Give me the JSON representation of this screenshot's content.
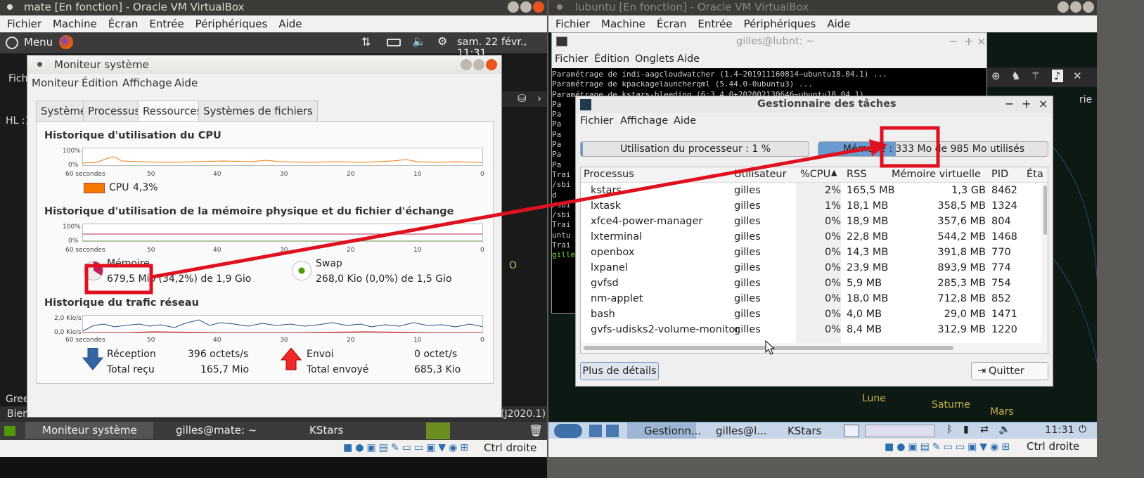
{
  "left_vm": {
    "title": "mate [En fonction] - Oracle VM VirtualBox",
    "menu": [
      "Fichier",
      "Machine",
      "Écran",
      "Entrée",
      "Périphériques",
      "Aide"
    ],
    "panel": {
      "menu_label": "Menu",
      "clock": "sam. 22 févr., 11:31"
    },
    "sysmon": {
      "title": "Moniteur système",
      "menu": [
        "Moniteur",
        "Édition",
        "Affichage",
        "Aide"
      ],
      "tabs": [
        "Système",
        "Processus",
        "Ressources",
        "Systèmes de fichiers"
      ],
      "cpu_title": "Historique d'utilisation du CPU",
      "mem_title": "Historique d'utilisation de la mémoire physique et du fichier d'échange",
      "net_title": "Historique du trafic réseau",
      "y100": "100%",
      "y0": "0%",
      "net_y1": "2,0 Kio/s",
      "net_y0": "0,0 Kio/s",
      "x_labels": [
        "60 secondes",
        "50",
        "40",
        "30",
        "20",
        "10",
        "0"
      ],
      "cpu_legend": "CPU",
      "cpu_value": "4,3%",
      "mem_label": "Mémoire",
      "mem_value": "679,5 Mio (34,2%) de 1,9 Gio",
      "swap_label": "Swap",
      "swap_value": "268,0 Kio (0,0%) de 1,5 Gio",
      "rx_label": "Réception",
      "rx_rate": "396 octets/s",
      "rx_total_label": "Total reçu",
      "rx_total": "165,7 Mio",
      "tx_label": "Envoi",
      "tx_rate": "0 octet/s",
      "tx_total_label": "Total envoyé",
      "tx_total": "685,3 Kio"
    },
    "bg_text": {
      "fichier": "Fich",
      "hl": "HL :1",
      "green": "Gree",
      "bien": "Bien",
      "version": "(J2020.1)",
      "o": "O"
    },
    "taskbar": [
      "Moniteur système",
      "gilles@mate: ~",
      "KStars"
    ],
    "host_key": "Ctrl droite"
  },
  "right_vm": {
    "title": "lubuntu [En fonction] - Oracle VM VirtualBox",
    "menu": [
      "Fichier",
      "Machine",
      "Écran",
      "Entrée",
      "Périphériques",
      "Aide"
    ],
    "terminal": {
      "title": "gilles@lubnt: ~",
      "menu": [
        "Fichier",
        "Édition",
        "Onglets",
        "Aide"
      ],
      "lines": [
        "Paramétrage de indi-aagcloudwatcher (1.4~201911160814~ubuntu18.04.1) ...",
        "Paramétrage de kpackagelauncherqml (5.44.0-0ubuntu3) ...",
        "Paramétrage de kstars-bleeding (6:3.4.0+202002130646~ubuntu18.04.1)",
        "Pa",
        "Pa",
        "Pa",
        "Pa",
        "Pa",
        "Pa",
        "Pa",
        "Trai",
        "",
        "/sbi",
        "d",
        "",
        "/sbi",
        "",
        "/sbi",
        "",
        "Trai",
        "untu",
        "Trai",
        "gille"
      ]
    },
    "taskmgr": {
      "title": "Gestionnaire des tâches",
      "menu": [
        "Fichier",
        "Affichage",
        "Aide"
      ],
      "cpu_usage": "Utilisation du processeur : 1 %",
      "mem_usage": "Mémoire : 333 Mo de 985 Mo utilisés",
      "mem_fraction": 0.338,
      "cpu_fraction": 0.01,
      "columns": [
        "Processus",
        "Utilisateur",
        "%CPU",
        "RSS",
        "Mémoire virtuelle",
        "PID",
        "Éta"
      ],
      "rows": [
        [
          "kstars",
          "gilles",
          "2%",
          "165,5 MB",
          "1,3 GB",
          "8462"
        ],
        [
          "lxtask",
          "gilles",
          "1%",
          "18,1 MB",
          "358,5 MB",
          "1324"
        ],
        [
          "xfce4-power-manager",
          "gilles",
          "0%",
          "18,9 MB",
          "357,6 MB",
          "804"
        ],
        [
          "lxterminal",
          "gilles",
          "0%",
          "22,8 MB",
          "544,2 MB",
          "1468"
        ],
        [
          "openbox",
          "gilles",
          "0%",
          "14,3 MB",
          "391,8 MB",
          "770"
        ],
        [
          "lxpanel",
          "gilles",
          "0%",
          "23,9 MB",
          "893,9 MB",
          "774"
        ],
        [
          "gvfsd",
          "gilles",
          "0%",
          "5,9 MB",
          "285,3 MB",
          "754"
        ],
        [
          "nm-applet",
          "gilles",
          "0%",
          "18,0 MB",
          "712,8 MB",
          "852"
        ],
        [
          "bash",
          "gilles",
          "0%",
          "4,0 MB",
          "29,0 MB",
          "1471"
        ],
        [
          "gvfs-udisks2-volume-monitor",
          "gilles",
          "0%",
          "8,4 MB",
          "312,9 MB",
          "1220"
        ]
      ],
      "details_button": "Plus de détails",
      "quit_button": "Quitter"
    },
    "sky": {
      "rie": "rie",
      "lune": "Lune",
      "saturne": "Saturne",
      "mars": "Mars"
    },
    "taskbar": [
      "Gestionn...",
      "gilles@l...",
      "KStars"
    ],
    "clock": "11:31",
    "host_key": "Ctrl droite"
  },
  "colors": {
    "highlight": "#e0101f",
    "ubuntu_orange": "#e95420",
    "cpu_orange": "#f57900"
  }
}
